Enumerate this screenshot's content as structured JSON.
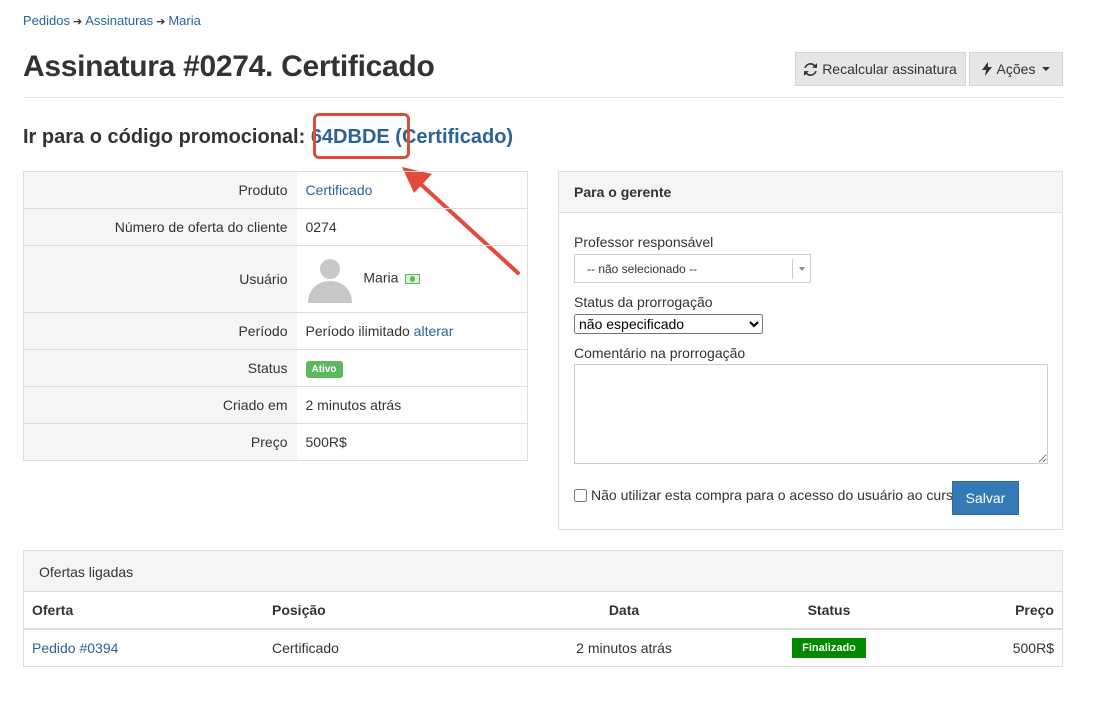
{
  "breadcrumb": {
    "items": [
      "Pedidos",
      "Assinaturas",
      "Maria"
    ]
  },
  "header": {
    "title": "Assinatura #0274. Certificado",
    "recalc_label": "Recalcular assinatura",
    "actions_label": "Ações"
  },
  "promo": {
    "prefix": "Ir para o código promocional:",
    "code": "64DBDE",
    "type": "(Certificado)"
  },
  "info": {
    "produto_label": "Produto",
    "produto_value": "Certificado",
    "numero_label": "Número de oferta do cliente",
    "numero_value": "0274",
    "usuario_label": "Usuário",
    "usuario_value": "Maria",
    "periodo_label": "Período",
    "periodo_value": "Período ilimitado",
    "periodo_link": "alterar",
    "status_label": "Status",
    "status_value": "Ativo",
    "criado_label": "Criado em",
    "criado_value": "2 minutos atrás",
    "preco_label": "Preço",
    "preco_value": "500R$"
  },
  "manager": {
    "heading": "Para o gerente",
    "professor_label": "Professor responsável",
    "professor_value": "-- não selecionado --",
    "prorrogacao_label": "Status da prorrogação",
    "prorrogacao_value": "não especificado",
    "comentario_label": "Comentário na prorrogação",
    "comentario_value": "",
    "checkbox_label": "Não utilizar esta compra para o acesso do usuário ao curso",
    "save_label": "Salvar"
  },
  "offers": {
    "heading": "Ofertas ligadas",
    "columns": [
      "Oferta",
      "Posição",
      "Data",
      "Status",
      "Preço"
    ],
    "rows": [
      {
        "oferta": "Pedido #0394",
        "posicao": "Certificado",
        "data": "2 minutos atrás",
        "status": "Finalizado",
        "preco": "500R$"
      }
    ]
  },
  "colors": {
    "link": "#2a6496",
    "primary": "#337ab7",
    "success": "#5cb85c",
    "finalized": "#008a00",
    "highlight": "#e04b3a"
  },
  "icons": {
    "recalc": "refresh-icon",
    "actions": "lightning-icon",
    "avatar": "user-silhouette-icon",
    "money": "money-icon"
  }
}
